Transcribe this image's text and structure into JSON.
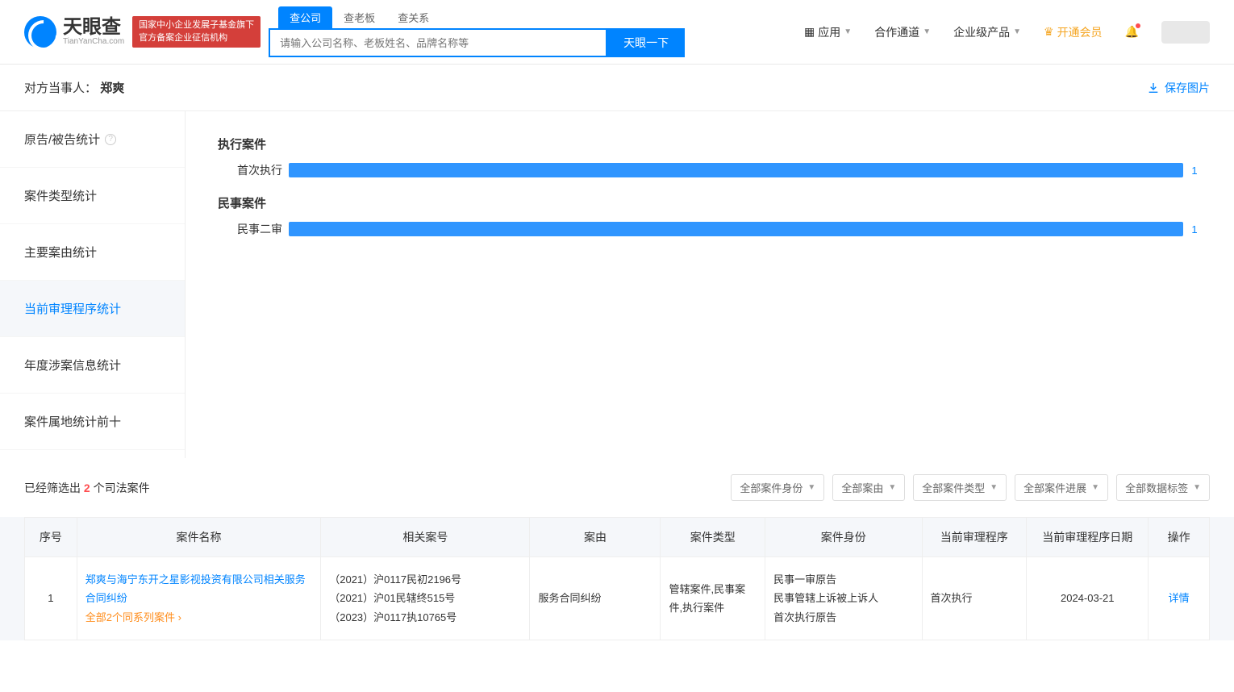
{
  "header": {
    "logo_main": "天眼查",
    "logo_sub": "TianYanCha.com",
    "logo_badge_line1": "国家中小企业发展子基金旗下",
    "logo_badge_line2": "官方备案企业征信机构",
    "search_tabs": [
      "查公司",
      "查老板",
      "查关系"
    ],
    "search_placeholder": "请输入公司名称、老板姓名、品牌名称等",
    "search_btn": "天眼一下",
    "nav": {
      "apps": "应用",
      "coop": "合作通道",
      "enterprise": "企业级产品",
      "vip": "开通会员"
    }
  },
  "party": {
    "label": "对方当事人：",
    "name": "郑爽",
    "save": "保存图片"
  },
  "sidebar": {
    "items": [
      "原告/被告统计",
      "案件类型统计",
      "主要案由统计",
      "当前审理程序统计",
      "年度涉案信息统计",
      "案件属地统计前十"
    ],
    "active_index": 3
  },
  "chart_data": [
    {
      "type": "bar",
      "title": "执行案件",
      "categories": [
        "首次执行"
      ],
      "values": [
        1
      ],
      "max": 1
    },
    {
      "type": "bar",
      "title": "民事案件",
      "categories": [
        "民事二审"
      ],
      "values": [
        1
      ],
      "max": 1
    }
  ],
  "filter": {
    "prefix": "已经筛选出 ",
    "count": "2",
    "suffix": " 个司法案件",
    "selects": [
      "全部案件身份",
      "全部案由",
      "全部案件类型",
      "全部案件进展",
      "全部数据标签"
    ]
  },
  "table": {
    "headers": [
      "序号",
      "案件名称",
      "相关案号",
      "案由",
      "案件类型",
      "案件身份",
      "当前审理程序",
      "当前审理程序日期",
      "操作"
    ],
    "row": {
      "idx": "1",
      "name": "郑爽与海宁东开之星影视投资有限公司相关服务合同纠纷",
      "name_sub": "全部2个同系列案件",
      "caseno_1": "（2021）沪0117民初2196号",
      "caseno_2": "（2021）沪01民辖终515号",
      "caseno_3": "（2023）沪0117执10765号",
      "reason": "服务合同纠纷",
      "type": "管辖案件,民事案件,执行案件",
      "identity_1": "民事一审原告",
      "identity_2": "民事管辖上诉被上诉人",
      "identity_3": "首次执行原告",
      "procedure": "首次执行",
      "date": "2024-03-21",
      "action": "详情"
    }
  }
}
